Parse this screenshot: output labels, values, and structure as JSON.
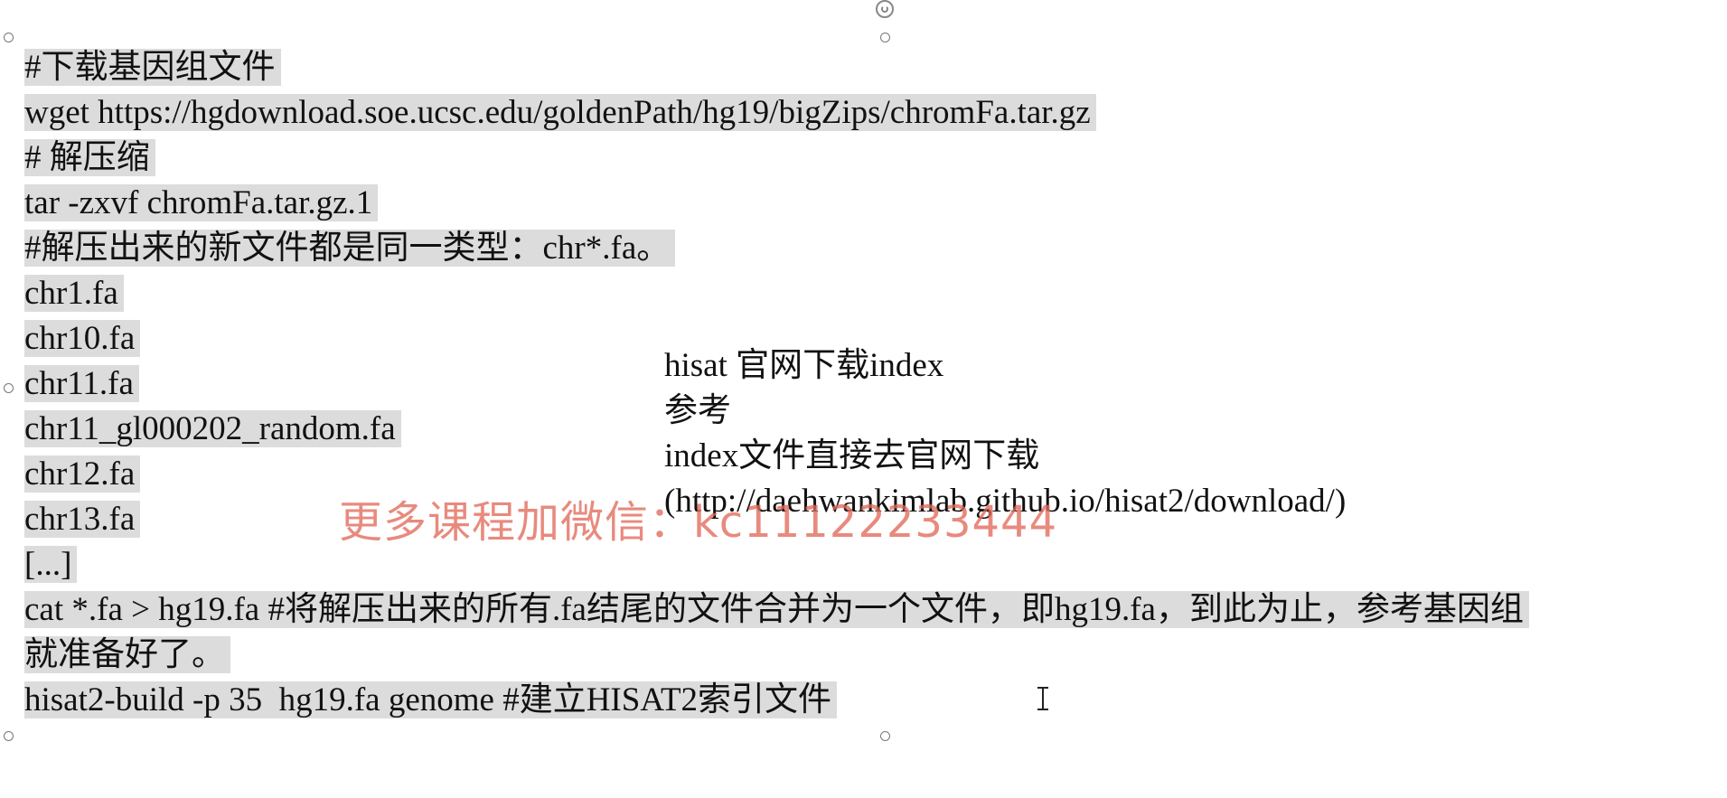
{
  "slide": {
    "selected_textbox": {
      "lines": [
        "#下载基因组文件",
        "wget https://hgdownload.soe.ucsc.edu/goldenPath/hg19/bigZips/chromFa.tar.gz",
        "# 解压缩",
        "tar -zxvf chromFa.tar.gz.1",
        "#解压出来的新文件都是同一类型：chr*.fa。",
        "chr1.fa",
        "chr10.fa",
        "chr11.fa",
        "chr11_gl000202_random.fa",
        "chr12.fa",
        "chr13.fa",
        "[...]",
        "cat *.fa > hg19.fa #将解压出来的所有.fa结尾的文件合并为一个文件，即hg19.fa，到此为止，参考基因组",
        "就准备好了。",
        "hisat2-build -p 35  hg19.fa genome #建立HISAT2索引文件"
      ]
    },
    "side_textbox": {
      "lines": [
        "hisat 官网下载index",
        "参考",
        "index文件直接去官网下载",
        "(http://daehwankimlab.github.io/hisat2/download/)"
      ]
    },
    "watermark": {
      "text": "更多课程加微信：kc11122233444",
      "color": "#e26a5a"
    },
    "selection_highlight_color": "#dcdcdc"
  }
}
